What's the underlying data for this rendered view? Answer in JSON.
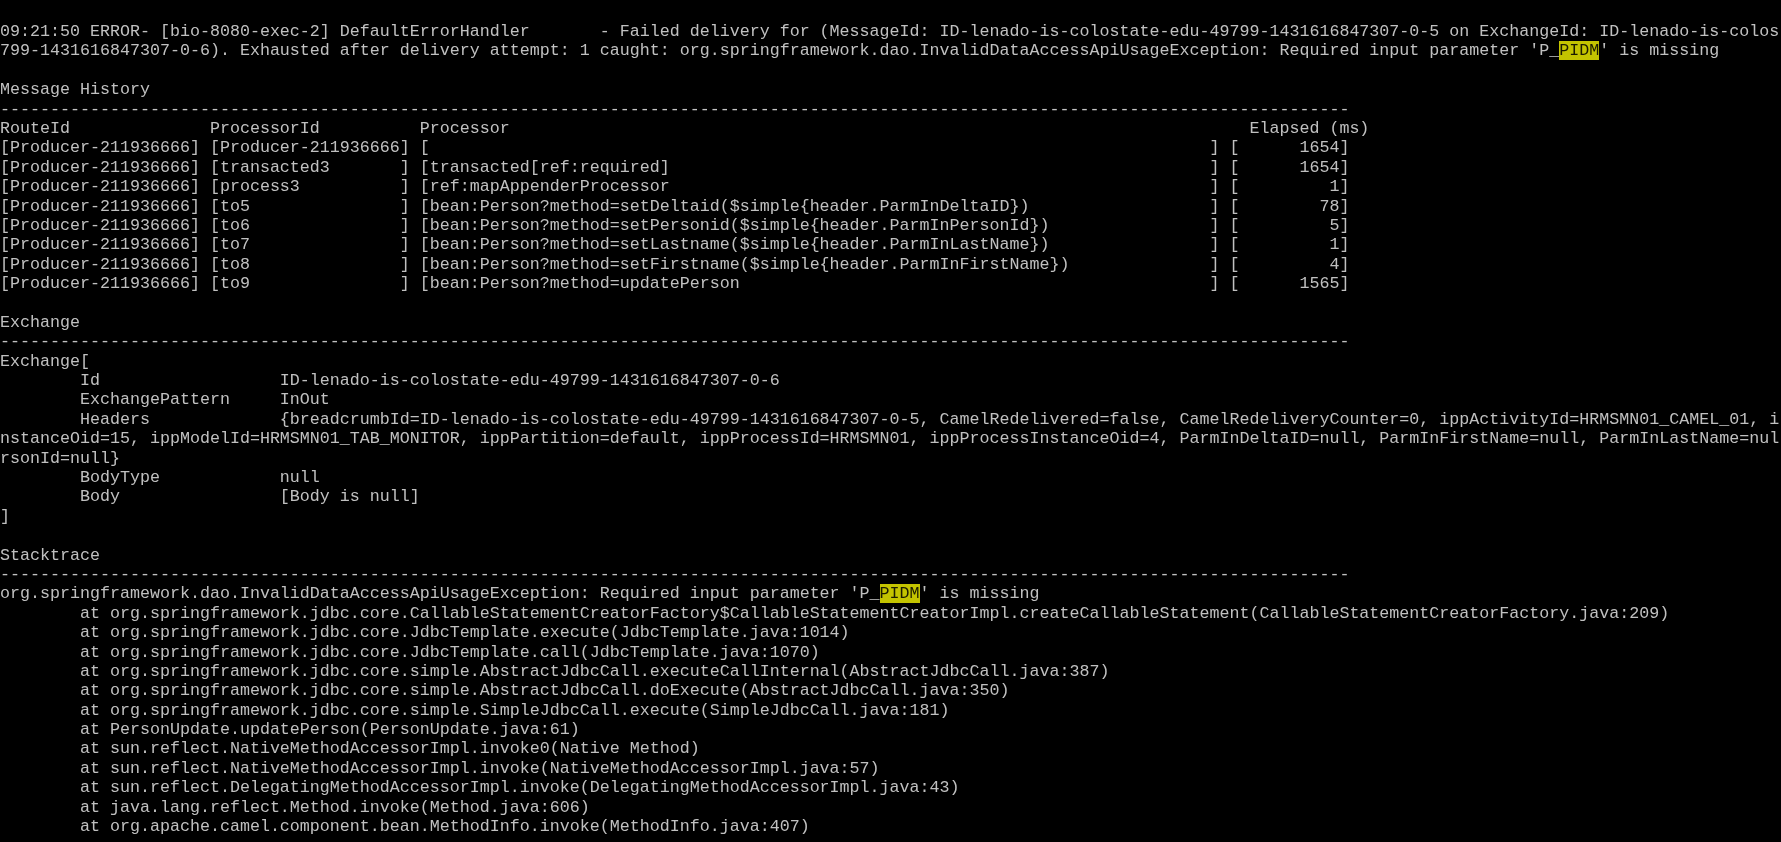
{
  "log_header": [
    {
      "parts": [
        {
          "text": "09:21:50 ERROR- [bio-8080-exec-2] DefaultErrorHandler       - Failed delivery for (MessageId: ID-lenado-is-colostate-edu-49799-1431616847307-0-5 on ExchangeId: ID-lenado-is-colos",
          "highlighted": false
        }
      ]
    },
    {
      "parts": [
        {
          "text": "799-1431616847307-0-6). Exhausted after delivery attempt: 1 caught: org.springframework.dao.InvalidDataAccessApiUsageException: Required input parameter 'P_",
          "highlighted": false
        },
        {
          "text": "PIDM",
          "highlighted": true
        },
        {
          "text": "' is missing",
          "highlighted": false
        }
      ]
    }
  ],
  "sections": [
    {
      "kind": "history",
      "title": "Message History",
      "rule": "---------------------------------------------------------------------------------------------------------------------------------------",
      "header": "RouteId              ProcessorId          Processor                                                                          Elapsed (ms)",
      "lines": [
        "[Producer-211936666] [Producer-211936666] [                                                                              ] [      1654]",
        "[Producer-211936666] [transacted3       ] [transacted[ref:required]                                                      ] [      1654]",
        "[Producer-211936666] [process3          ] [ref:mapAppenderProcessor                                                      ] [         1]",
        "[Producer-211936666] [to5               ] [bean:Person?method=setDeltaid($simple{header.ParmInDeltaID})                  ] [        78]",
        "[Producer-211936666] [to6               ] [bean:Person?method=setPersonid($simple{header.ParmInPersonId})                ] [         5]",
        "[Producer-211936666] [to7               ] [bean:Person?method=setLastname($simple{header.ParmInLastName})                ] [         1]",
        "[Producer-211936666] [to8               ] [bean:Person?method=setFirstname($simple{header.ParmInFirstName})              ] [         4]",
        "[Producer-211936666] [to9               ] [bean:Person?method=updatePerson                                               ] [      1565]"
      ]
    },
    {
      "kind": "exchange",
      "title": "Exchange",
      "rule": "---------------------------------------------------------------------------------------------------------------------------------------",
      "lines": [
        "Exchange[",
        "        Id                  ID-lenado-is-colostate-edu-49799-1431616847307-0-6",
        "        ExchangePattern     InOut",
        "        Headers             {breadcrumbId=ID-lenado-is-colostate-edu-49799-1431616847307-0-5, CamelRedelivered=false, CamelRedeliveryCounter=0, ippActivityId=HRMSMN01_CAMEL_01, i",
        "nstanceOid=15, ippModelId=HRMSMN01_TAB_MONITOR, ippPartition=default, ippProcessId=HRMSMN01, ippProcessInstanceOid=4, ParmInDeltaID=null, ParmInFirstName=null, ParmInLastName=nul",
        "rsonId=null}",
        "        BodyType            null",
        "        Body                [Body is null]",
        "]"
      ]
    },
    {
      "kind": "stacktrace",
      "title": "Stacktrace",
      "rule": "---------------------------------------------------------------------------------------------------------------------------------------",
      "exception": {
        "parts": [
          {
            "text": "org.springframework.dao.InvalidDataAccessApiUsageException: Required input parameter 'P_",
            "highlighted": false
          },
          {
            "text": "PIDM",
            "highlighted": true
          },
          {
            "text": "' is missing",
            "highlighted": false
          }
        ]
      },
      "lines": [
        "        at org.springframework.jdbc.core.CallableStatementCreatorFactory$CallableStatementCreatorImpl.createCallableStatement(CallableStatementCreatorFactory.java:209)",
        "        at org.springframework.jdbc.core.JdbcTemplate.execute(JdbcTemplate.java:1014)",
        "        at org.springframework.jdbc.core.JdbcTemplate.call(JdbcTemplate.java:1070)",
        "        at org.springframework.jdbc.core.simple.AbstractJdbcCall.executeCallInternal(AbstractJdbcCall.java:387)",
        "        at org.springframework.jdbc.core.simple.AbstractJdbcCall.doExecute(AbstractJdbcCall.java:350)",
        "        at org.springframework.jdbc.core.simple.SimpleJdbcCall.execute(SimpleJdbcCall.java:181)",
        "        at PersonUpdate.updatePerson(PersonUpdate.java:61)",
        "        at sun.reflect.NativeMethodAccessorImpl.invoke0(Native Method)",
        "        at sun.reflect.NativeMethodAccessorImpl.invoke(NativeMethodAccessorImpl.java:57)",
        "        at sun.reflect.DelegatingMethodAccessorImpl.invoke(DelegatingMethodAccessorImpl.java:43)",
        "        at java.lang.reflect.Method.invoke(Method.java:606)",
        "        at org.apache.camel.component.bean.MethodInfo.invoke(MethodInfo.java:407)"
      ]
    }
  ]
}
